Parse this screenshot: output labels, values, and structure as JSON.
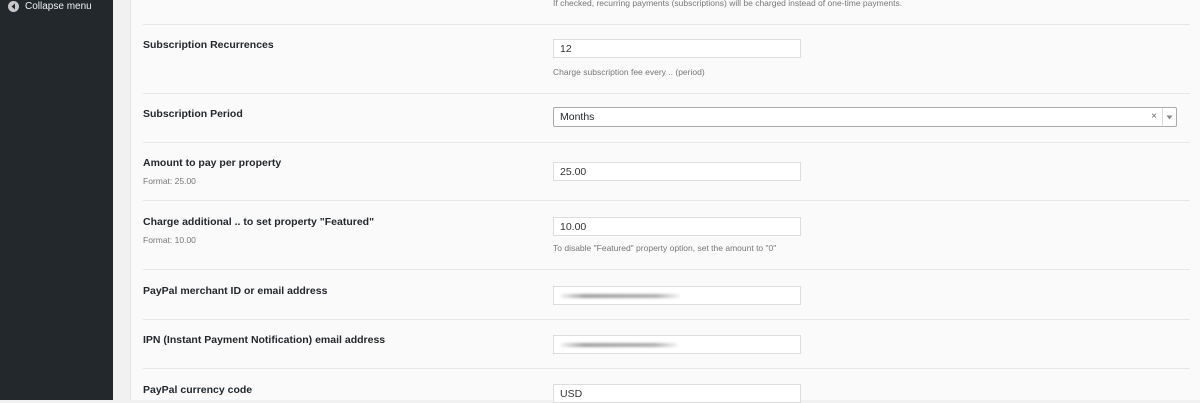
{
  "sidebar": {
    "collapse_label": "Collapse menu"
  },
  "form": {
    "recurring_hint": "If checked, recurring payments (subscriptions) will be charged instead of one-time payments.",
    "subscription_recurrences": {
      "label": "Subscription Recurrences",
      "value": "12",
      "description": "Charge subscription fee every .. (period)"
    },
    "subscription_period": {
      "label": "Subscription Period",
      "value": "Months",
      "clear_glyph": "×"
    },
    "amount_per_property": {
      "label": "Amount to pay per property",
      "format": "Format: 25.00",
      "value": "25.00"
    },
    "featured_charge": {
      "label": "Charge additional .. to set property \"Featured\"",
      "format": "Format: 10.00",
      "value": "10.00",
      "description": "To disable \"Featured\" property option, set the amount to \"0\""
    },
    "paypal_merchant": {
      "label": "PayPal merchant ID or email address"
    },
    "ipn_email": {
      "label": "IPN (Instant Payment Notification) email address"
    },
    "currency_code": {
      "label": "PayPal currency code",
      "value": "USD"
    }
  }
}
